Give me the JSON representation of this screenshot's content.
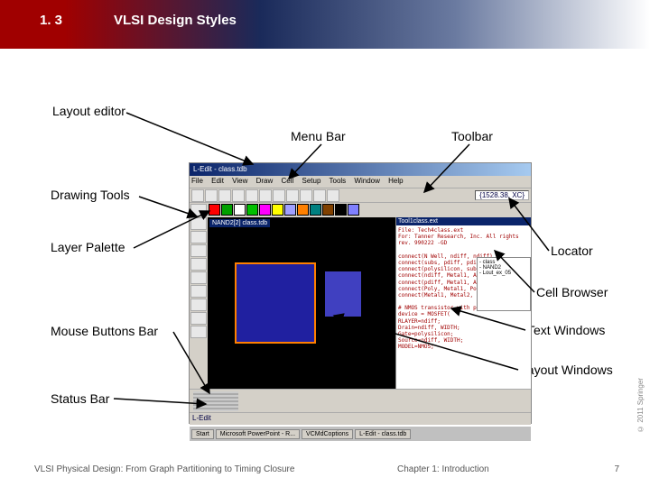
{
  "header": {
    "number": "1. 3",
    "title": "VLSI Design Styles"
  },
  "labels": {
    "layout_editor": "Layout editor",
    "menu_bar": "Menu Bar",
    "toolbar": "Toolbar",
    "drawing_tools": "Drawing Tools",
    "layer_palette": "Layer Palette",
    "locator": "Locator",
    "cell_browser": "Cell Browser",
    "mouse_buttons_bar": "Mouse Buttons Bar",
    "text_windows": "Text Windows",
    "layout_windows": "Layout Windows",
    "status_bar": "Status Bar"
  },
  "app": {
    "title": "L-Edit - class.tdb",
    "menu": [
      "File",
      "Edit",
      "View",
      "Draw",
      "Cell",
      "Setup",
      "Tools",
      "Window",
      "Help"
    ],
    "coord": "{1528.38, XC}",
    "tab": "NAND2[2]",
    "subtab": "class.tdb",
    "rpanel_hdr": "Tool1class.ext",
    "rpanel_lines": [
      "File: Tech4class.ext",
      "For: Tanner Research, Inc. All rights",
      "rev. 990222 -GD",
      "",
      "connect(N Well, ndiff, ndiff)",
      "connect(subs, pdiff, pdiff)",
      "connect(polysilicon, subs, subs)",
      "connect(ndiff, Metal1, Active Contact)",
      "connect(pdiff, Metal1, Active Contact)",
      "connect(Poly, Metal1, Poly Contact)",
      "connect(Metal1, Metal2, Via)",
      "",
      "# NMOS transistor with poly1 gate",
      "device = MOSFET(",
      "  RLAYER=ndiff;",
      "  Drain=ndiff, WIDTH;",
      "  Gate=polysilicon;",
      "  Source=ndiff, WIDTH;",
      "  MODEL=NMOS;"
    ],
    "cellbrowser": [
      "- class",
      "  - NAND2",
      "  - Lout_ex_05"
    ],
    "status": "L-Edit",
    "taskbar": [
      "Start",
      "Microsoft PowerPoint - R...",
      "VCMdCoptions",
      "L-Edit - class.tdb"
    ]
  },
  "footer": {
    "left": "VLSI Physical Design: From Graph Partitioning to Timing Closure",
    "mid": "Chapter 1: Introduction",
    "right": "7",
    "copyright": "© 2011 Springer"
  },
  "colors": {
    "swatches": [
      "#ff0000",
      "#00a000",
      "#ffffff",
      "#00c000",
      "#ff00ff",
      "#ffff00",
      "#a0a0ff",
      "#ff8000",
      "#008080",
      "#804000",
      "#000000",
      "#8080ff"
    ]
  }
}
